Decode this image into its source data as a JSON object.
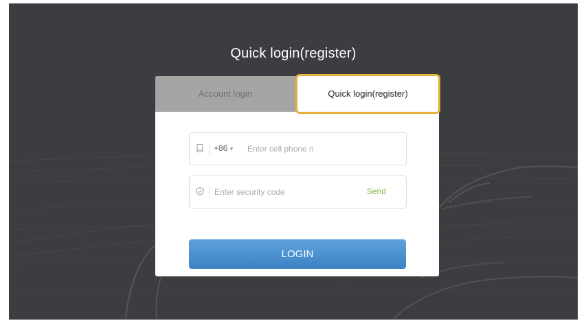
{
  "page": {
    "title": "Quick login(register)"
  },
  "tabs": {
    "account": "Account login",
    "quick": "Quick login(register)",
    "active": "quick"
  },
  "phone": {
    "country_code": "+86",
    "placeholder": "Enter cell phone n"
  },
  "security": {
    "placeholder": "Enter security code",
    "send_label": "Send"
  },
  "login": {
    "label": "LOGIN"
  },
  "icons": {
    "phone": "phone-icon",
    "security": "shield-icon",
    "dropdown": "chevron-down-icon"
  },
  "colors": {
    "background": "#3c3d40",
    "tab_bar": "#a5a6a3",
    "highlight": "#e2b23a",
    "send": "#86b43b",
    "button": "#4a90d0"
  }
}
